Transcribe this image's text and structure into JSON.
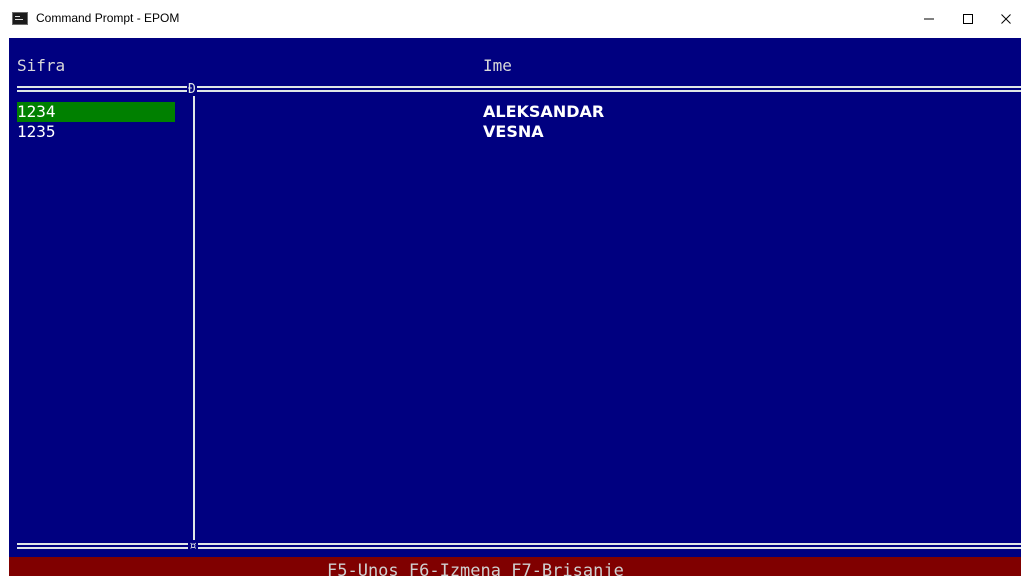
{
  "window": {
    "title": "Command Prompt - EPOM",
    "icon": "cmd-icon",
    "controls": [
      "minimize-icon",
      "maximize-icon",
      "close-icon"
    ]
  },
  "table": {
    "headers": {
      "code": "Sifra",
      "name": "Ime"
    },
    "rows": [
      {
        "code": "1234",
        "name": "ALEKSANDAR",
        "selected": true
      },
      {
        "code": "1235",
        "name": "VESNA",
        "selected": false
      }
    ],
    "junction_top": "Ð",
    "junction_bottom": "¤"
  },
  "status_bar": {
    "text": "F5-Unos F6-Izmena F7-Brisanje"
  },
  "colors": {
    "console_bg": "#000080",
    "selection_bg": "#008000",
    "status_bg": "#800000",
    "text": "#ffffff"
  }
}
